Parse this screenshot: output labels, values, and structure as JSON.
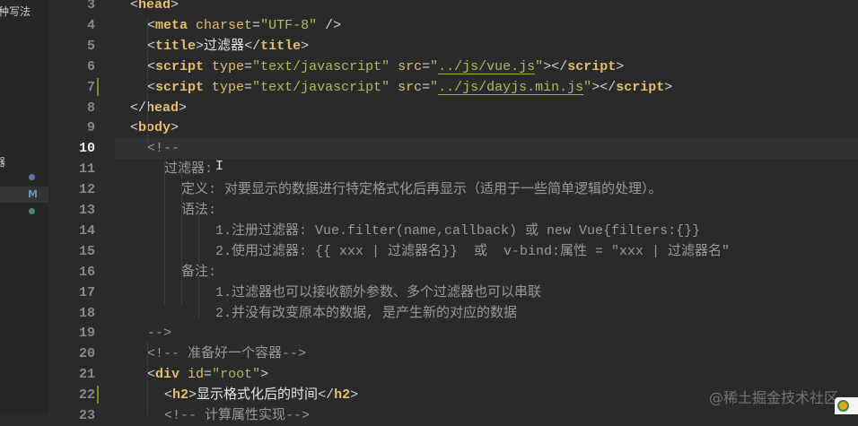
{
  "sidebar": {
    "items": [
      {
        "label": "种写法"
      },
      {
        "label": "器"
      }
    ],
    "modified_badge": "M"
  },
  "colors": {
    "tag": "#e8bf6a",
    "string": "#a5c25c",
    "comment": "#9a9a9a",
    "background": "#2a2a2a"
  },
  "editor": {
    "current_line": 10,
    "lines": [
      {
        "n": "3",
        "indent": 0,
        "tokens": [
          [
            "br",
            "<"
          ],
          [
            "tag",
            "head"
          ],
          [
            "br",
            ">"
          ]
        ]
      },
      {
        "n": "4",
        "indent": 1,
        "tokens": [
          [
            "br",
            "<"
          ],
          [
            "tag",
            "meta "
          ],
          [
            "attr",
            "charset"
          ],
          [
            "br",
            "="
          ],
          [
            "str",
            "\"UTF-8\""
          ],
          [
            "br",
            " />"
          ]
        ]
      },
      {
        "n": "5",
        "indent": 1,
        "tokens": [
          [
            "br",
            "<"
          ],
          [
            "tag",
            "title"
          ],
          [
            "br",
            ">"
          ],
          [
            "txt",
            "过滤器"
          ],
          [
            "br",
            "</"
          ],
          [
            "tag",
            "title"
          ],
          [
            "br",
            ">"
          ]
        ]
      },
      {
        "n": "6",
        "indent": 1,
        "tokens": [
          [
            "br",
            "<"
          ],
          [
            "tag",
            "script "
          ],
          [
            "attr",
            "type"
          ],
          [
            "br",
            "="
          ],
          [
            "str",
            "\"text/javascript\" "
          ],
          [
            "attr",
            "src"
          ],
          [
            "br",
            "="
          ],
          [
            "str",
            "\""
          ],
          [
            "lnk",
            "../js/vue.js"
          ],
          [
            "str",
            "\""
          ],
          [
            "br",
            "></"
          ],
          [
            "tag",
            "script"
          ],
          [
            "br",
            ">"
          ]
        ]
      },
      {
        "n": "7",
        "indent": 1,
        "mod": true,
        "tokens": [
          [
            "br",
            "<"
          ],
          [
            "tag",
            "script "
          ],
          [
            "attr",
            "type"
          ],
          [
            "br",
            "="
          ],
          [
            "str",
            "\"text/javascript\" "
          ],
          [
            "attr",
            "src"
          ],
          [
            "br",
            "="
          ],
          [
            "str",
            "\""
          ],
          [
            "lnk",
            "../js/dayjs.min.js"
          ],
          [
            "str",
            "\""
          ],
          [
            "br",
            "></"
          ],
          [
            "tag",
            "script"
          ],
          [
            "br",
            ">"
          ]
        ]
      },
      {
        "n": "8",
        "indent": 0,
        "tokens": [
          [
            "br",
            "</"
          ],
          [
            "tag",
            "head"
          ],
          [
            "br",
            ">"
          ]
        ]
      },
      {
        "n": "9",
        "indent": 0,
        "tokens": [
          [
            "br",
            "<"
          ],
          [
            "tag",
            "body"
          ],
          [
            "br",
            ">"
          ]
        ]
      },
      {
        "n": "10",
        "indent": 1,
        "tokens": [
          [
            "cmt",
            "<!--"
          ]
        ]
      },
      {
        "n": "11",
        "indent": 2,
        "tokens": [
          [
            "cmt",
            "过滤器:"
          ]
        ]
      },
      {
        "n": "12",
        "indent": 3,
        "tokens": [
          [
            "cmt",
            "定义: 对要显示的数据进行特定格式化后再显示（适用于一些简单逻辑的处理）。"
          ]
        ]
      },
      {
        "n": "13",
        "indent": 3,
        "tokens": [
          [
            "cmt",
            "语法:"
          ]
        ]
      },
      {
        "n": "14",
        "indent": 5,
        "tokens": [
          [
            "cmt",
            "1.注册过滤器: Vue.filter(name,callback) 或 new Vue{filters:{}}"
          ]
        ]
      },
      {
        "n": "15",
        "indent": 5,
        "tokens": [
          [
            "cmt",
            "2.使用过滤器: {{ xxx | 过滤器名}}  或  v-bind:属性 = \"xxx | 过滤器名\""
          ]
        ]
      },
      {
        "n": "16",
        "indent": 3,
        "tokens": [
          [
            "cmt",
            "备注:"
          ]
        ]
      },
      {
        "n": "17",
        "indent": 5,
        "tokens": [
          [
            "cmt",
            "1.过滤器也可以接收额外参数、多个过滤器也可以串联"
          ]
        ]
      },
      {
        "n": "18",
        "indent": 5,
        "tokens": [
          [
            "cmt",
            "2.并没有改变原本的数据, 是产生新的对应的数据"
          ]
        ]
      },
      {
        "n": "19",
        "indent": 1,
        "tokens": [
          [
            "cmt",
            "-->"
          ]
        ]
      },
      {
        "n": "20",
        "indent": 1,
        "tokens": [
          [
            "cmt",
            "<!-- 准备好一个容器-->"
          ]
        ]
      },
      {
        "n": "21",
        "indent": 1,
        "tokens": [
          [
            "br",
            "<"
          ],
          [
            "tag",
            "div "
          ],
          [
            "attr",
            "id"
          ],
          [
            "br",
            "="
          ],
          [
            "str",
            "\"root\""
          ],
          [
            "br",
            ">"
          ]
        ]
      },
      {
        "n": "22",
        "indent": 2,
        "mod": true,
        "tokens": [
          [
            "br",
            "<"
          ],
          [
            "tag",
            "h2"
          ],
          [
            "br",
            ">"
          ],
          [
            "txt",
            "显示格式化后的时间"
          ],
          [
            "br",
            "</"
          ],
          [
            "tag",
            "h2"
          ],
          [
            "br",
            ">"
          ]
        ]
      },
      {
        "n": "23",
        "indent": 2,
        "tokens": [
          [
            "cmt",
            "<!-- 计算属性实现-->"
          ]
        ]
      }
    ]
  },
  "watermark": "@稀土掘金技术社区"
}
